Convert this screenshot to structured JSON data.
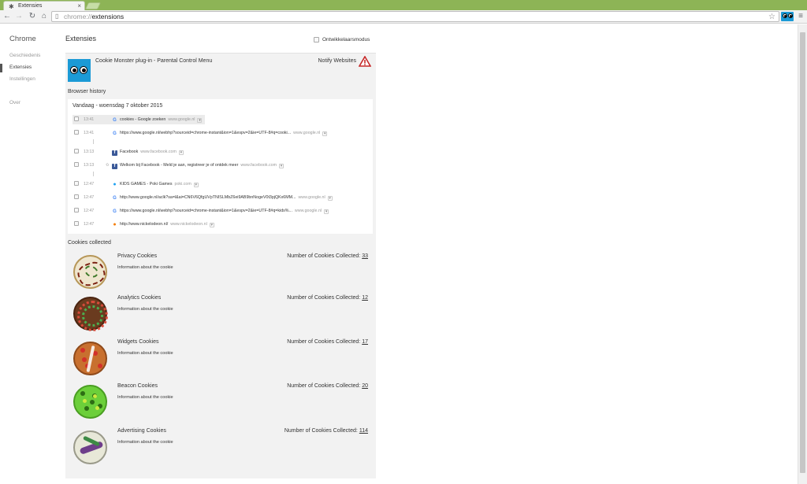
{
  "browser": {
    "tab_title": "Extensies",
    "tab_close": "×",
    "url_scheme": "chrome://",
    "url_host": "extensions"
  },
  "sidebar": {
    "brand": "Chrome",
    "items": [
      {
        "label": "Geschiedenis"
      },
      {
        "label": "Extensies"
      },
      {
        "label": "Instellingen"
      },
      {
        "label": "Over"
      }
    ]
  },
  "main": {
    "title": "Extensies",
    "dev_mode_label": "Ontwikkelaarsmodus"
  },
  "extension": {
    "name": "Cookie Monster plug-in - Parental Control Menu",
    "notify_label": "Notify Websites",
    "accent_color": "#1b9ad6"
  },
  "history": {
    "section_title": "Browser history",
    "day_label": "Vandaag - woensdag 7 oktober 2015",
    "rows": [
      {
        "time": "13:41",
        "title": "cookies - Google zoeken",
        "domain": "www.google.nl",
        "icon": "google-icon"
      },
      {
        "time": "13:41",
        "title": "https://www.google.nl/webhp?sourceid=chrome-instant&ion=1&espv=2&ie=UTF-8#q=cooki...",
        "domain": "www.google.nl",
        "icon": "google-icon"
      },
      {
        "time": "13:13",
        "title": "Facebook",
        "domain": "www.facebook.com",
        "icon": "facebook-icon"
      },
      {
        "time": "13:13",
        "title": "Welkom bij Facebook - Meld je aan, registreer je of ontdek meer",
        "domain": "www.facebook.com",
        "icon": "facebook-icon"
      },
      {
        "time": "12:47",
        "title": "KIDS GAMES - Poki Games",
        "domain": "poki.com",
        "icon": "poki-icon"
      },
      {
        "time": "12:47",
        "title": "http://www.google.nl/aclk?sa=l&ai=CN6V6QfgUVpTNISLMbZ6ei9AB9bnNogeV0t3pjQKx6MM...",
        "domain": "www.google.nl",
        "icon": "google-icon"
      },
      {
        "time": "12:47",
        "title": "https://www.google.nl/webhp?sourceid=chrome-instant&ion=1&espv=2&ie=UTF-8#q=kids%...",
        "domain": "www.google.nl",
        "icon": "google-icon"
      },
      {
        "time": "12:47",
        "title": "http://www.nickelodeon.nl/",
        "domain": "www.nickelodeon.nl",
        "icon": "nickelodeon-icon"
      }
    ]
  },
  "cookies": {
    "section_title": "Cookies collected",
    "count_label": "Number of Cookies Collected:",
    "items": [
      {
        "name": "Privacy Cookies",
        "info": "Information about the cookie",
        "count": "33"
      },
      {
        "name": "Analytics Cookies",
        "info": "Information about the cookie",
        "count": "12"
      },
      {
        "name": "Widgets Cookies",
        "info": "Information about the cookie",
        "count": "17"
      },
      {
        "name": "Beacon Cookies",
        "info": "Information about the cookie",
        "count": "20"
      },
      {
        "name": "Advertising Cookies",
        "info": "Information about the cookie",
        "count": "114"
      }
    ]
  }
}
